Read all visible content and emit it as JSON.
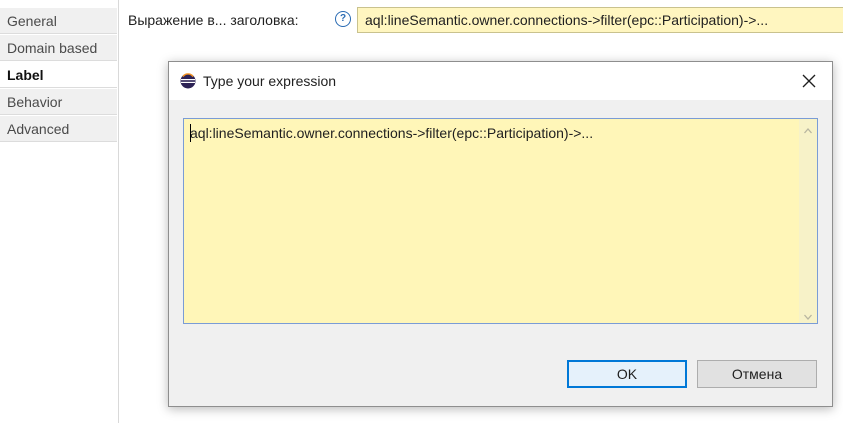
{
  "tabs": [
    {
      "label": "General",
      "active": false
    },
    {
      "label": "Domain based",
      "active": false
    },
    {
      "label": "Label",
      "active": true
    },
    {
      "label": "Behavior",
      "active": false
    },
    {
      "label": "Advanced",
      "active": false
    }
  ],
  "property": {
    "label": "Выражение в... заголовка:",
    "help_glyph": "?",
    "value": "aql:lineSemantic.owner.connections->filter(epc::Participation)->..."
  },
  "dialog": {
    "title": "Type your expression",
    "expression": "aql:lineSemantic.owner.connections->filter(epc::Participation)->...",
    "ok_label": "OK",
    "cancel_label": "Отмена"
  },
  "colors": {
    "expression_bg": "#fff6b8",
    "ok_border": "#0078d7",
    "help_blue": "#2a6bb3"
  },
  "icons": {
    "app": "eclipse-icon",
    "help": "help-icon",
    "close": "close-icon"
  }
}
